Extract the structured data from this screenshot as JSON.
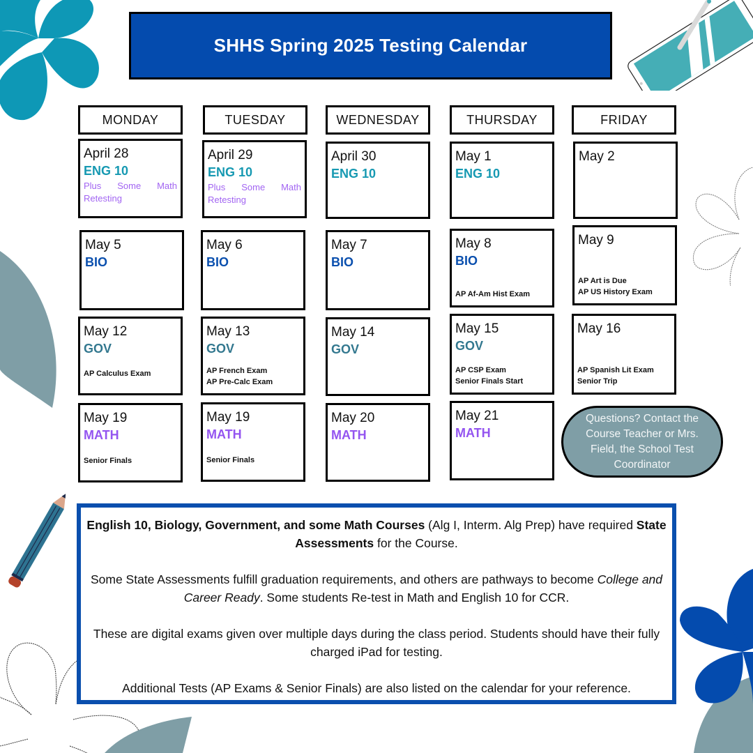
{
  "title": "SHHS Spring 2025 Testing Calendar",
  "colors": {
    "title_bg": "#044bae",
    "eng": "#1699b2",
    "bio": "#0a4fae",
    "gov": "#33788f",
    "math": "#9455f0",
    "note": "#a265f2",
    "contact_bg": "#7f9ea6",
    "info_border": "#0a4fae"
  },
  "days": [
    "MONDAY",
    "TUESDAY",
    "WEDNESDAY",
    "THURSDAY",
    "FRIDAY"
  ],
  "weeks": [
    [
      {
        "date": "April 28",
        "subject": "ENG 10",
        "subject_class": "eng",
        "note": "Plus Some Math Retesting",
        "events": []
      },
      {
        "date": "April 29",
        "subject": "ENG 10",
        "subject_class": "eng",
        "note": "Plus Some Math Retesting",
        "events": []
      },
      {
        "date": "April 30",
        "subject": "ENG 10",
        "subject_class": "eng",
        "note": "",
        "events": []
      },
      {
        "date": "May 1",
        "subject": "ENG 10",
        "subject_class": "eng",
        "note": "",
        "events": []
      },
      {
        "date": "May 2",
        "subject": "",
        "subject_class": "",
        "note": "",
        "events": []
      }
    ],
    [
      {
        "date": "May 5",
        "subject": "BIO",
        "subject_class": "bio",
        "note": "",
        "events": []
      },
      {
        "date": "May 6",
        "subject": "BIO",
        "subject_class": "bio",
        "note": "",
        "events": []
      },
      {
        "date": "May 7",
        "subject": "BIO",
        "subject_class": "bio",
        "note": "",
        "events": []
      },
      {
        "date": "May 8",
        "subject": "BIO",
        "subject_class": "bio",
        "note": "",
        "events": [
          "AP Af-Am Hist Exam"
        ]
      },
      {
        "date": "May 9",
        "subject": "",
        "subject_class": "",
        "note": "",
        "events": [
          "AP Art is Due",
          "AP US History Exam"
        ]
      }
    ],
    [
      {
        "date": "May 12",
        "subject": "GOV",
        "subject_class": "gov",
        "note": "",
        "events": [
          "AP Calculus Exam"
        ]
      },
      {
        "date": "May 13",
        "subject": "GOV",
        "subject_class": "gov",
        "note": "",
        "events": [
          "AP French Exam",
          "AP Pre-Calc Exam"
        ]
      },
      {
        "date": "May 14",
        "subject": "GOV",
        "subject_class": "gov",
        "note": "",
        "events": []
      },
      {
        "date": "May 15",
        "subject": "GOV",
        "subject_class": "gov",
        "note": "",
        "events": [
          "AP CSP Exam",
          "Senior Finals Start"
        ]
      },
      {
        "date": "May 16",
        "subject": "",
        "subject_class": "",
        "note": "",
        "events": [
          "AP Spanish Lit Exam",
          "Senior Trip"
        ]
      }
    ],
    [
      {
        "date": "May 19",
        "subject": "MATH",
        "subject_class": "math",
        "note": "",
        "events": [
          "Senior Finals"
        ]
      },
      {
        "date": "May 19",
        "subject": "MATH",
        "subject_class": "math",
        "note": "",
        "events": [
          "Senior Finals"
        ]
      },
      {
        "date": "May 20",
        "subject": "MATH",
        "subject_class": "math",
        "note": "",
        "events": []
      },
      {
        "date": "May 21",
        "subject": "MATH",
        "subject_class": "math",
        "note": "",
        "events": []
      }
    ]
  ],
  "contact": "Questions? Contact the Course Teacher or Mrs. Field, the School Test Coordinator",
  "info": {
    "p1": {
      "bold1": "English 10, Biology, Government, and some Math Courses",
      "text1": " (Alg I, Interm. Alg Prep) have required ",
      "bold2": "State Assessments",
      "text2": " for the Course."
    },
    "p2": {
      "text1": "Some State Assessments fulfill graduation requirements, and others are pathways to become ",
      "italic": "College and Career Ready",
      "text2": ".  Some students Re-test in Math and English 10 for CCR."
    },
    "p3": "These are digital exams given over multiple days during the class period.  Students should have their fully charged iPad for testing.",
    "p4": "Additional Tests (AP Exams & Senior Finals) are also listed on the calendar for your reference."
  }
}
